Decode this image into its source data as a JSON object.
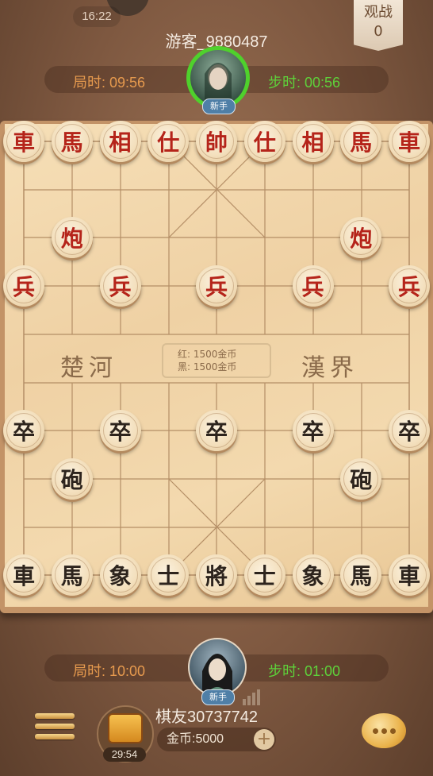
{
  "top": {
    "clock": "16:22",
    "watch_label": "观战",
    "watch_count": "0"
  },
  "opponent": {
    "name": "游客_9880487",
    "game_time_label": "局时: 09:56",
    "step_time_label": "步时: 00:56",
    "badge": "新手"
  },
  "board": {
    "river_left": "楚河",
    "river_right": "漢界",
    "red_coins": "红: 1500金币",
    "black_coins": "黑: 1500金币",
    "red_pieces": [
      {
        "char": "車",
        "col": 0,
        "row": 0
      },
      {
        "char": "馬",
        "col": 1,
        "row": 0
      },
      {
        "char": "相",
        "col": 2,
        "row": 0
      },
      {
        "char": "仕",
        "col": 3,
        "row": 0
      },
      {
        "char": "帥",
        "col": 4,
        "row": 0
      },
      {
        "char": "仕",
        "col": 5,
        "row": 0
      },
      {
        "char": "相",
        "col": 6,
        "row": 0
      },
      {
        "char": "馬",
        "col": 7,
        "row": 0
      },
      {
        "char": "車",
        "col": 8,
        "row": 0
      },
      {
        "char": "炮",
        "col": 1,
        "row": 2
      },
      {
        "char": "炮",
        "col": 7,
        "row": 2
      },
      {
        "char": "兵",
        "col": 0,
        "row": 3
      },
      {
        "char": "兵",
        "col": 2,
        "row": 3
      },
      {
        "char": "兵",
        "col": 4,
        "row": 3
      },
      {
        "char": "兵",
        "col": 6,
        "row": 3
      },
      {
        "char": "兵",
        "col": 8,
        "row": 3
      }
    ],
    "black_pieces": [
      {
        "char": "卒",
        "col": 0,
        "row": 6
      },
      {
        "char": "卒",
        "col": 2,
        "row": 6
      },
      {
        "char": "卒",
        "col": 4,
        "row": 6
      },
      {
        "char": "卒",
        "col": 6,
        "row": 6
      },
      {
        "char": "卒",
        "col": 8,
        "row": 6
      },
      {
        "char": "砲",
        "col": 1,
        "row": 7
      },
      {
        "char": "砲",
        "col": 7,
        "row": 7
      },
      {
        "char": "車",
        "col": 0,
        "row": 9
      },
      {
        "char": "馬",
        "col": 1,
        "row": 9
      },
      {
        "char": "象",
        "col": 2,
        "row": 9
      },
      {
        "char": "士",
        "col": 3,
        "row": 9
      },
      {
        "char": "將",
        "col": 4,
        "row": 9
      },
      {
        "char": "士",
        "col": 5,
        "row": 9
      },
      {
        "char": "象",
        "col": 6,
        "row": 9
      },
      {
        "char": "馬",
        "col": 7,
        "row": 9
      },
      {
        "char": "車",
        "col": 8,
        "row": 9
      }
    ]
  },
  "player": {
    "name": "棋友30737742",
    "game_time_label": "局时: 10:00",
    "step_time_label": "步时: 01:00",
    "badge": "新手",
    "coins_label": "金币:5000",
    "chest_timer": "29:54"
  },
  "colors": {
    "red_piece": "#b5241a",
    "black_piece": "#2d241d",
    "timer_green": "#5ed13a",
    "timer_orange": "#e69a4e"
  }
}
